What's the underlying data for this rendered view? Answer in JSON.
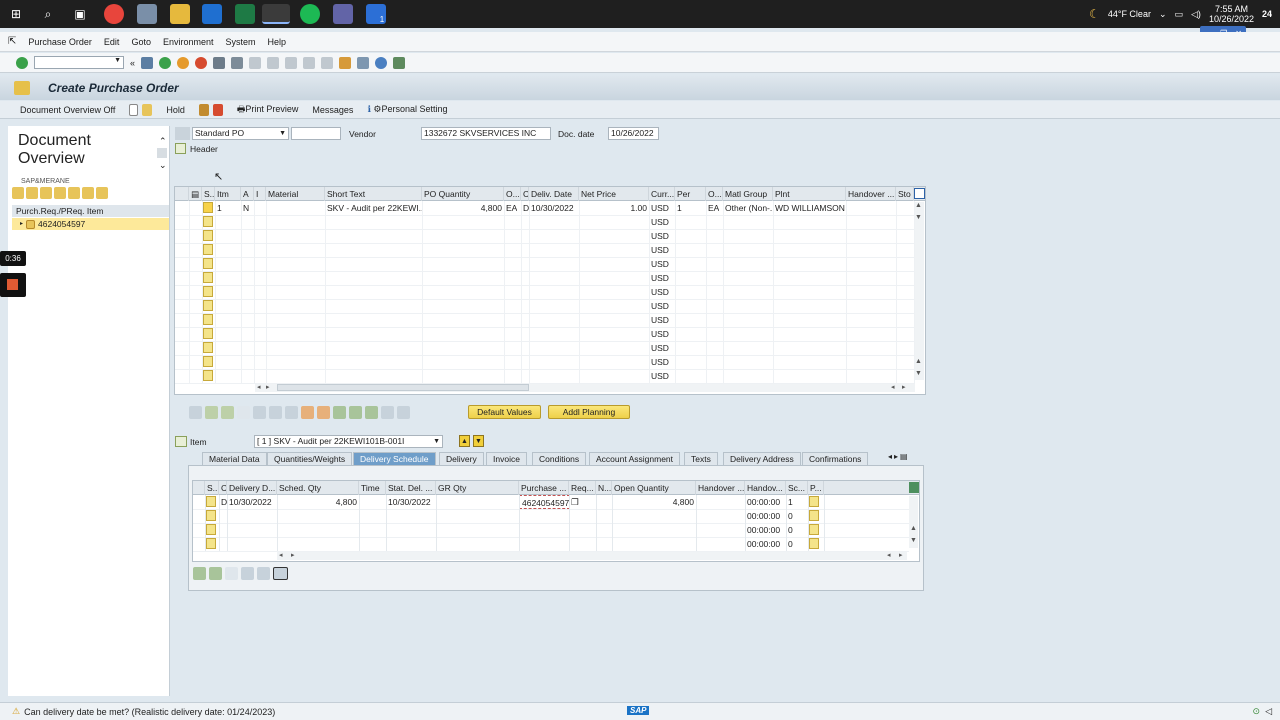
{
  "taskbar": {
    "weather": "44°F  Clear",
    "time": "7:55 AM",
    "date": "10/26/2022",
    "notification_count": "24",
    "badge_count": "1"
  },
  "menu": [
    "Purchase Order",
    "Edit",
    "Goto",
    "Environment",
    "System",
    "Help"
  ],
  "title": "Create Purchase Order",
  "app_toolbar": {
    "doc_overview_off": "Document Overview Off",
    "hold": "Hold",
    "print_preview": "Print Preview",
    "messages": "Messages",
    "personal_setting": "Personal Setting"
  },
  "left_panel": {
    "title": "Document Overview",
    "partial_label": "SAP&MERANE",
    "tree_header": "Purch.Req./PReq. Item",
    "tree_item": "4624054597"
  },
  "timer": "0:36",
  "header_fields": {
    "doc_type": "Standard PO",
    "vendor_label": "Vendor",
    "vendor_value": "1332672 SKVSERVICES INC",
    "doc_date_label": "Doc. date",
    "doc_date_value": "10/26/2022",
    "header_label": "Header"
  },
  "items_grid": {
    "columns": [
      "S..",
      "Itm",
      "A",
      "I",
      "Material",
      "Short Text",
      "PO Quantity",
      "O...",
      "C",
      "Deliv. Date",
      "Net Price",
      "Curr...",
      "Per",
      "O...",
      "Matl Group",
      "Plnt",
      "Handover ...",
      "Sto"
    ],
    "row1": {
      "itm": "1",
      "a": "N",
      "short_text": "SKV - Audit per 22KEWI...",
      "po_qty": "4,800",
      "unit": "EA",
      "c": "D",
      "deliv_date": "10/30/2022",
      "net_price": "1.00",
      "curr": "USD",
      "per": "1",
      "o": "EA",
      "matl_group": "Other (Non-...",
      "plnt": "WD WILLIAMSON ..."
    },
    "empty_curr": "USD"
  },
  "buttons": {
    "default_values": "Default Values",
    "addl_planning": "Addl Planning"
  },
  "item_detail": {
    "label": "Item",
    "selected": "[ 1 ] SKV - Audit per 22KEWI101B-001I",
    "tabs": [
      "Material Data",
      "Quantities/Weights",
      "Delivery Schedule",
      "Delivery",
      "Invoice",
      "Conditions",
      "Account Assignment",
      "Texts",
      "Delivery Address",
      "Confirmations"
    ],
    "active_tab": "Delivery Schedule"
  },
  "schedule_grid": {
    "columns": [
      "S..",
      "C",
      "Delivery D...",
      "Sched. Qty",
      "Time",
      "Stat. Del. ...",
      "GR Qty",
      "Purchase ...",
      "Req...",
      "N...",
      "Open Quantity",
      "Handover ...",
      "Handov...",
      "Sc...",
      "P..."
    ],
    "row1": {
      "c": "D",
      "delivery_date": "10/30/2022",
      "sched_qty": "4,800",
      "stat_del": "10/30/2022",
      "purchase": "4624054597",
      "open_qty": "4,800",
      "handov": "00:00:00",
      "sc": "1"
    },
    "rows_extra": [
      {
        "handov": "00:00:00",
        "sc": "0"
      },
      {
        "handov": "00:00:00",
        "sc": "0"
      },
      {
        "handov": "00:00:00",
        "sc": "0"
      }
    ]
  },
  "status_message": "Can delivery date be met? (Realistic delivery date: 01/24/2023)",
  "sap_logo": "SAP"
}
